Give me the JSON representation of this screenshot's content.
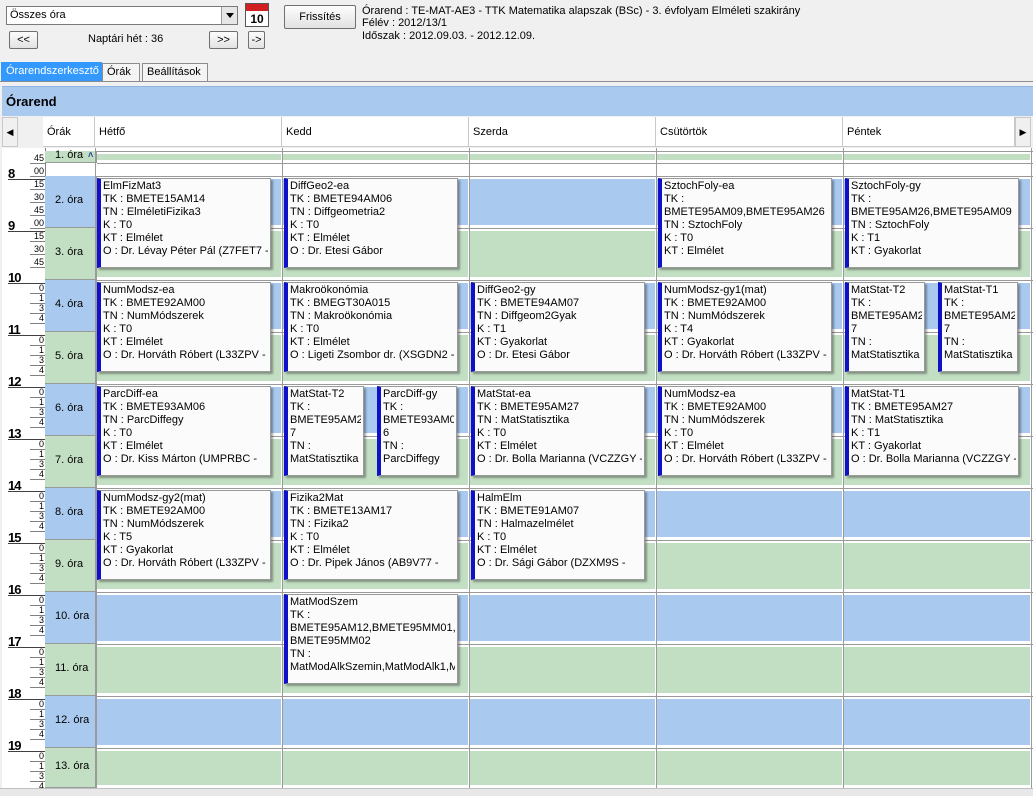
{
  "toolbar": {
    "filter_value": "Összes óra",
    "refresh_label": "Frissítés",
    "prev_label": "<<",
    "next_label": ">>",
    "jump_label": "->",
    "week_label": "Naptári hét : 36",
    "calendar_icon_num": "10"
  },
  "info": {
    "line1": "Órarend : TE-MAT-AE3 - TTK Matematika alapszak (BSc) - 3. évfolyam Elméleti szakirány",
    "line2": "Félév : 2012/13/1",
    "line3": "Időszak : 2012.09.03. - 2012.12.09."
  },
  "tabs": [
    "Órarendszerkesztő",
    "Órák",
    "Beállítások"
  ],
  "band_title": "Órarend",
  "columns": [
    "Órák",
    "Hétfő",
    "Kedd",
    "Szerda",
    "Csütörtök",
    "Péntek"
  ],
  "hours": [
    "8",
    "9",
    "10",
    "11",
    "12",
    "13",
    "14",
    "15",
    "16",
    "17",
    "18",
    "19"
  ],
  "ora_labels": [
    "1. óra",
    "2. óra",
    "3. óra",
    "4. óra",
    "5. óra",
    "6. óra",
    "7. óra",
    "8. óra",
    "9. óra",
    "10. óra",
    "11. óra",
    "12. óra",
    "13. óra"
  ],
  "minute_labels": {
    "first": [
      "45",
      "00",
      "15",
      "30",
      "45",
      "00",
      "15",
      "30",
      "45"
    ],
    "rest": [
      "0",
      "1",
      "3",
      "4"
    ]
  },
  "cards": [
    {
      "id": "mon-1",
      "lines": [
        "ElmFizMat3",
        "TK : BMETE15AM14",
        "TN : ElméletiFizika3",
        "K : T0",
        "KT : Elmélet",
        "O :  Dr. Lévay Péter Pál (Z7FET7 -"
      ]
    },
    {
      "id": "tue-1",
      "lines": [
        "DiffGeo2-ea",
        "TK : BMETE94AM06",
        "TN : Diffgeometria2",
        "K : T0",
        "KT : Elmélet",
        "O :  Dr. Etesi Gábor"
      ]
    },
    {
      "id": "thu-1",
      "lines": [
        "SztochFoly-ea",
        "TK :",
        "BMETE95AM09,BMETE95AM26",
        "TN : SztochFoly",
        "K : T0",
        "KT : Elmélet"
      ]
    },
    {
      "id": "fri-1",
      "lines": [
        "SztochFoly-gy",
        "TK :",
        "BMETE95AM26,BMETE95AM09",
        "TN : SztochFoly",
        "K : T1",
        "KT : Gyakorlat"
      ]
    },
    {
      "id": "mon-2",
      "lines": [
        "NumModsz-ea",
        "TK : BMETE92AM00",
        "TN : NumMódszerek",
        "K : T0",
        "KT : Elmélet",
        "O :  Dr. Horváth Róbert (L33ZPV -"
      ]
    },
    {
      "id": "tue-2",
      "lines": [
        "Makroökonómia",
        "TK : BMEGT30A015",
        "TN : Makroökonómia",
        "K : T0",
        "KT : Elmélet",
        "O :  Ligeti Zsombor dr. (XSGDN2 -"
      ]
    },
    {
      "id": "wed-2",
      "lines": [
        "DiffGeo2-gy",
        "TK : BMETE94AM07",
        "TN : Diffgeom2Gyak",
        "K : T1",
        "KT : Gyakorlat",
        "O :  Dr. Etesi Gábor"
      ]
    },
    {
      "id": "thu-2",
      "lines": [
        "NumModsz-gy1(mat)",
        "TK : BMETE92AM00",
        "TN : NumMódszerek",
        "K : T4",
        "KT : Gyakorlat",
        "O :  Dr. Horváth Róbert (L33ZPV -"
      ]
    },
    {
      "id": "fri-2a",
      "lines": [
        "MatStat-T2",
        "TK :",
        "BMETE95AM2",
        "7",
        "TN :",
        "MatStatisztika"
      ]
    },
    {
      "id": "fri-2b",
      "lines": [
        "MatStat-T1",
        "TK :",
        "BMETE95AM2",
        "7",
        "TN :",
        "MatStatisztika"
      ]
    },
    {
      "id": "mon-3",
      "lines": [
        "ParcDiff-ea",
        "TK : BMETE93AM06",
        "TN : ParcDiffegy",
        "K : T0",
        "KT : Elmélet",
        "O :  Dr. Kiss Márton (UMPRBC -"
      ]
    },
    {
      "id": "tue-3a",
      "lines": [
        "MatStat-T2",
        "TK :",
        "BMETE95AM2",
        "7",
        "TN :",
        "MatStatisztika"
      ]
    },
    {
      "id": "tue-3b",
      "lines": [
        "ParcDiff-gy",
        "TK :",
        "BMETE93AM0",
        "6",
        "TN :",
        "ParcDiffegy"
      ]
    },
    {
      "id": "wed-3",
      "lines": [
        "MatStat-ea",
        "TK : BMETE95AM27",
        "TN : MatStatisztika",
        "K : T0",
        "KT : Elmélet",
        "O :  Dr. Bolla Marianna (VCZZGY -"
      ]
    },
    {
      "id": "thu-3",
      "lines": [
        "NumModsz-ea",
        "TK : BMETE92AM00",
        "TN : NumMódszerek",
        "K : T0",
        "KT : Elmélet",
        "O :  Dr. Horváth Róbert (L33ZPV -"
      ]
    },
    {
      "id": "fri-3",
      "lines": [
        "MatStat-T1",
        "TK : BMETE95AM27",
        "TN : MatStatisztika",
        "K : T1",
        "KT : Gyakorlat",
        "O :  Dr. Bolla Marianna (VCZZGY -"
      ]
    },
    {
      "id": "mon-4",
      "lines": [
        "NumModsz-gy2(mat)",
        "TK : BMETE92AM00",
        "TN : NumMódszerek",
        "K : T5",
        "KT : Gyakorlat",
        "O :  Dr. Horváth Róbert (L33ZPV -"
      ]
    },
    {
      "id": "tue-4",
      "lines": [
        "Fizika2Mat",
        "TK : BMETE13AM17",
        "TN : Fizika2",
        "K : T0",
        "KT : Elmélet",
        "O :  Dr. Pipek János (AB9V77 -"
      ]
    },
    {
      "id": "wed-4",
      "lines": [
        "HalmElm",
        "TK : BMETE91AM07",
        "TN : Halmazelmélet",
        "K : T0",
        "KT : Elmélet",
        "O :  Dr. Sági Gábor (DZXM9S -"
      ]
    },
    {
      "id": "tue-5",
      "lines": [
        "MatModSzem",
        "TK :",
        "BMETE95AM12,BMETE95MM01,",
        "BMETE95MM02",
        "TN :",
        "MatModAlkSzemin,MatModAlk1,M"
      ]
    }
  ]
}
